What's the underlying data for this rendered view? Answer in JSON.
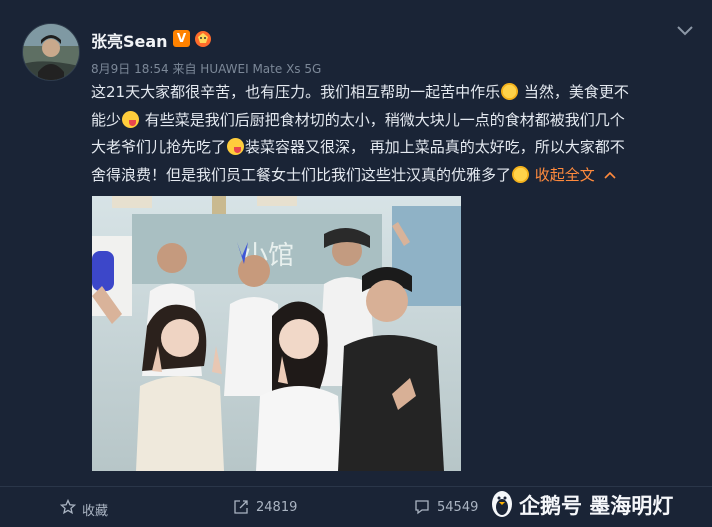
{
  "user": {
    "name": "张亮Sean",
    "verified_badge": "V",
    "meta": "8月9日 18:54 来自 HUAWEI Mate Xs 5G"
  },
  "post": {
    "lines": [
      {
        "segments": [
          {
            "t": "text",
            "v": "这21天大家都很辛苦，也有压力。我们相互帮助一起苦中作乐"
          },
          {
            "t": "emoji",
            "v": "sun"
          },
          {
            "t": "text",
            "v": " 当然，美食更不"
          }
        ]
      },
      {
        "segments": [
          {
            "t": "text",
            "v": "能少"
          },
          {
            "t": "emoji",
            "v": "wink"
          },
          {
            "t": "text",
            "v": " 有些菜是我们后厨把食材切的太小，稍微大块儿一点的食材都被我们几个"
          }
        ]
      },
      {
        "segments": [
          {
            "t": "text",
            "v": "大老爷们儿抢先吃了"
          },
          {
            "t": "emoji",
            "v": "wink"
          },
          {
            "t": "text",
            "v": "装菜容器又很深， 再加上菜品真的太好吃，所以大家都不"
          }
        ]
      },
      {
        "segments": [
          {
            "t": "text",
            "v": "舍得浪费！但是我们员工餐女士们比我们这些壮汉真的优雅多了"
          },
          {
            "t": "emoji",
            "v": "sun"
          },
          {
            "t": "text",
            "v": " "
          },
          {
            "t": "link",
            "v": "收起全文"
          }
        ]
      }
    ]
  },
  "photo": {
    "sign_text": "小馆"
  },
  "footer": {
    "favorite_label": "收藏",
    "share_count": "24819",
    "comment_count": "54549"
  },
  "watermark": {
    "text": "企鹅号 墨海明灯"
  },
  "colors": {
    "background": "#1a2436",
    "link": "#ff8a3d",
    "meta": "#7c8898"
  },
  "icons": [
    "chevron-down-icon",
    "star-icon",
    "share-icon",
    "comment-icon",
    "penguin-icon"
  ]
}
